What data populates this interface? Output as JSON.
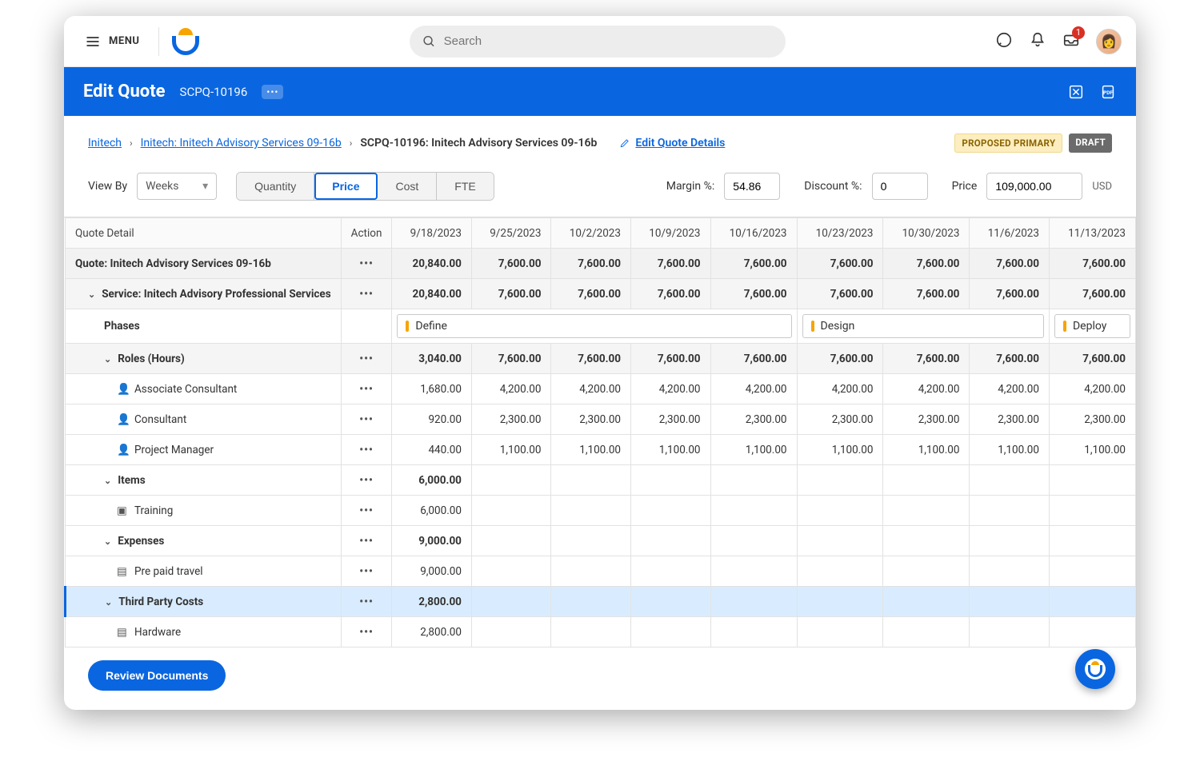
{
  "topbar": {
    "menu_label": "MENU",
    "search_placeholder": "Search",
    "inbox_badge": "1"
  },
  "header": {
    "title": "Edit Quote",
    "quote_id": "SCPQ-10196"
  },
  "breadcrumb": {
    "c1": "Initech",
    "c2": "Initech: Initech Advisory Services 09-16b",
    "c3": "SCPQ-10196: Initech Advisory Services 09-16b",
    "edit_link": "Edit Quote Details"
  },
  "badges": {
    "primary": "PROPOSED PRIMARY",
    "draft": "DRAFT"
  },
  "params": {
    "view_by_label": "View By",
    "view_by_value": "Weeks",
    "seg_quantity": "Quantity",
    "seg_price": "Price",
    "seg_cost": "Cost",
    "seg_fte": "FTE",
    "margin_label": "Margin %:",
    "margin_value": "54.86",
    "discount_label": "Discount %:",
    "discount_value": "0",
    "price_label": "Price",
    "price_value": "109,000.00",
    "currency": "USD"
  },
  "columns": {
    "c0": "Quote Detail",
    "c1": "Action",
    "c2": "9/18/2023",
    "c3": "9/25/2023",
    "c4": "10/2/2023",
    "c5": "10/9/2023",
    "c6": "10/16/2023",
    "c7": "10/23/2023",
    "c8": "10/30/2023",
    "c9": "11/6/2023",
    "c10": "11/13/2023"
  },
  "rows": {
    "quote": {
      "label": "Quote: Initech Advisory Services 09-16b",
      "v": [
        "20,840.00",
        "7,600.00",
        "7,600.00",
        "7,600.00",
        "7,600.00",
        "7,600.00",
        "7,600.00",
        "7,600.00",
        "7,600.00"
      ]
    },
    "service": {
      "label": "Service: Initech Advisory Professional Services",
      "v": [
        "20,840.00",
        "7,600.00",
        "7,600.00",
        "7,600.00",
        "7,600.00",
        "7,600.00",
        "7,600.00",
        "7,600.00",
        "7,600.00"
      ]
    },
    "phases_label": "Phases",
    "phases": {
      "p1": "Define",
      "p2": "Design",
      "p3": "Deploy"
    },
    "roles": {
      "label": "Roles (Hours)",
      "v": [
        "3,040.00",
        "7,600.00",
        "7,600.00",
        "7,600.00",
        "7,600.00",
        "7,600.00",
        "7,600.00",
        "7,600.00",
        "7,600.00"
      ]
    },
    "assoc": {
      "label": "Associate Consultant",
      "v": [
        "1,680.00",
        "4,200.00",
        "4,200.00",
        "4,200.00",
        "4,200.00",
        "4,200.00",
        "4,200.00",
        "4,200.00",
        "4,200.00"
      ]
    },
    "cons": {
      "label": "Consultant",
      "v": [
        "920.00",
        "2,300.00",
        "2,300.00",
        "2,300.00",
        "2,300.00",
        "2,300.00",
        "2,300.00",
        "2,300.00",
        "2,300.00"
      ]
    },
    "pm": {
      "label": "Project Manager",
      "v": [
        "440.00",
        "1,100.00",
        "1,100.00",
        "1,100.00",
        "1,100.00",
        "1,100.00",
        "1,100.00",
        "1,100.00",
        "1,100.00"
      ]
    },
    "items": {
      "label": "Items",
      "v0": "6,000.00"
    },
    "training": {
      "label": "Training",
      "v0": "6,000.00"
    },
    "expenses": {
      "label": "Expenses",
      "v0": "9,000.00"
    },
    "prepaid": {
      "label": "Pre paid travel",
      "v0": "9,000.00"
    },
    "third": {
      "label": "Third Party Costs",
      "v0": "2,800.00"
    },
    "hardware": {
      "label": "Hardware",
      "v0": "2,800.00"
    }
  },
  "footer": {
    "review_btn": "Review Documents"
  }
}
